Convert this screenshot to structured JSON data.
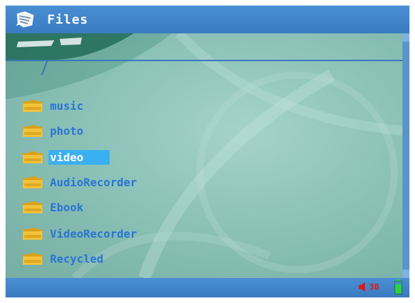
{
  "window": {
    "title": "Files",
    "title_icon": "file-manager-icon"
  },
  "folders": [
    {
      "name": "music",
      "icon": "folder-icon",
      "selected": false
    },
    {
      "name": "photo",
      "icon": "folder-icon",
      "selected": false
    },
    {
      "name": "video",
      "icon": "folder-icon",
      "selected": true
    },
    {
      "name": "AudioRecorder",
      "icon": "folder-icon",
      "selected": false
    },
    {
      "name": "Ebook",
      "icon": "folder-icon",
      "selected": false
    },
    {
      "name": "VideoRecorder",
      "icon": "folder-icon",
      "selected": false
    },
    {
      "name": "Recycled",
      "icon": "folder-icon",
      "selected": false
    }
  ],
  "status": {
    "volume_icon": "speaker-icon",
    "volume_text": "30",
    "battery_icon": "battery-icon",
    "battery_level": 0.8
  },
  "colors": {
    "bar": "#3f7fbf",
    "label": "#2a74d4",
    "selection": "#3ab0f0",
    "volume": "#e01818",
    "battery": "#2fd23a"
  }
}
